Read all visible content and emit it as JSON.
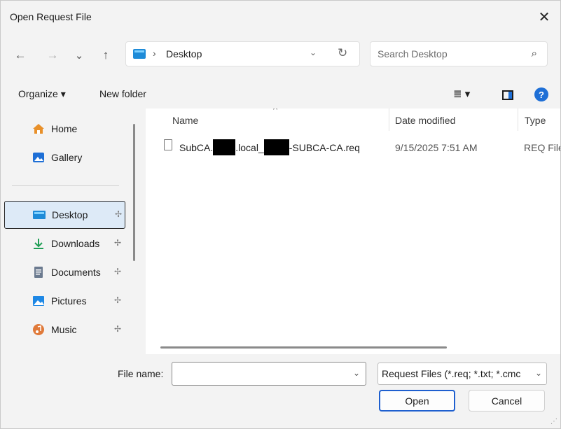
{
  "window": {
    "title": "Open Request File"
  },
  "nav": {
    "back_icon": "←",
    "forward_icon": "→",
    "recent_icon": "⌄",
    "up_icon": "↑",
    "location": "Desktop",
    "separator": "›",
    "address_dropdown": "⌄",
    "refresh_icon": "↻"
  },
  "search": {
    "placeholder": "Search Desktop",
    "icon": "⌕"
  },
  "toolbar": {
    "organize_label": "Organize ▾",
    "new_folder_label": "New folder",
    "view_icon": "≣ ▾",
    "help_label": "?"
  },
  "sidebar": {
    "items": [
      {
        "label": "Home",
        "icon": "home-icon"
      },
      {
        "label": "Gallery",
        "icon": "gallery-icon"
      },
      {
        "label": "Desktop",
        "icon": "desktop-folder-icon",
        "pinned": true,
        "selected": true
      },
      {
        "label": "Downloads",
        "icon": "download-icon",
        "pinned": true
      },
      {
        "label": "Documents",
        "icon": "documents-icon",
        "pinned": true
      },
      {
        "label": "Pictures",
        "icon": "pictures-icon",
        "pinned": true
      },
      {
        "label": "Music",
        "icon": "music-icon",
        "pinned": true
      }
    ],
    "pin_glyph": "📌"
  },
  "columns": {
    "name": "Name",
    "date": "Date modified",
    "type": "Type"
  },
  "files": [
    {
      "name_parts": [
        "SubCA.",
        ".local_",
        "-SUBCA-CA.req"
      ],
      "date": "9/15/2025 7:51 AM",
      "type": "REQ File"
    }
  ],
  "bottom": {
    "file_name_label": "File name:",
    "file_name_value": "",
    "filter_value": "Request Files (*.req; *.txt; *.cmc",
    "open_label": "Open",
    "cancel_label": "Cancel"
  },
  "colors": {
    "accent": "#1e5fcf",
    "selected_bg": "#ddeaf7",
    "chrome_bg": "#f3f3f3"
  }
}
